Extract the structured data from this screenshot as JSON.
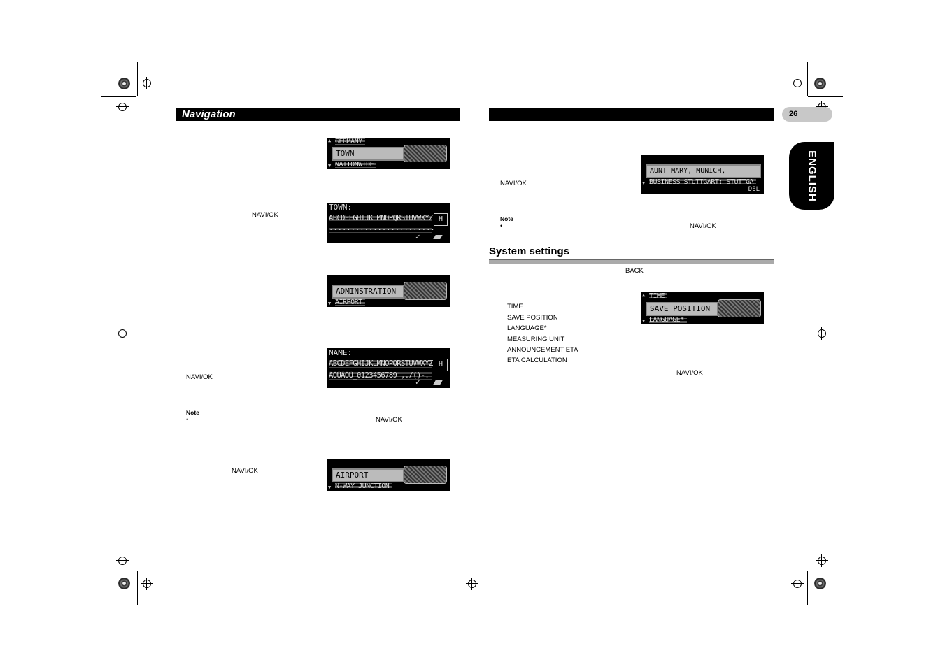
{
  "header": {
    "left_title": "Navigation",
    "right_title": "",
    "page_number": "26",
    "language_tab": "ENGLISH"
  },
  "screens": {
    "country": {
      "top": "GERMANY",
      "selected": "TOWN",
      "bottom": "NATIONWIDE"
    },
    "town_entry": {
      "label": "TOWN:",
      "keys": "ABCDEFGHIJKLMNOPQRSTUVWXYZ",
      "current": "H",
      "input": "························",
      "ok": "✓"
    },
    "category": {
      "selected": "ADMINSTRATION",
      "bottom": "AIRPORT"
    },
    "name_entry": {
      "label": "NAME:",
      "keys": "ABCDEFGHIJKLMNOPQRSTUVWXYZ",
      "keys2": "ÄÖÜÄÖÜ_0123456789',./()-.",
      "current": "H",
      "ok": "✓"
    },
    "airport": {
      "selected": "AIRPORT",
      "bottom": "N-WAY JUNCTION"
    },
    "address_book": {
      "selected": "AUNT MARY, MUNICH,",
      "bottom": "BUSINESS STUTTGART: STUTTGA",
      "del": "DEL"
    },
    "system": {
      "top": "TIME",
      "selected": "SAVE POSITION",
      "bottom": "LANGUAGE*"
    }
  },
  "left": {
    "navi_ok_1": "NAVI/OK",
    "navi_ok_2": "NAVI/OK",
    "note_label": "Note",
    "note_bullet": "•",
    "navi_ok_3": "NAVI/OK",
    "navi_ok_4": "NAVI/OK"
  },
  "right": {
    "navi_ok_1": "NAVI/OK",
    "note_label": "Note",
    "note_bullet": "•",
    "navi_ok_2": "NAVI/OK",
    "section_title": "System settings",
    "back": "BACK",
    "menu_items": [
      "TIME",
      "SAVE POSITION",
      "LANGUAGE*",
      "MEASURING UNIT",
      "ANNOUNCEMENT ETA",
      "ETA CALCULATION"
    ],
    "navi_ok_3": "NAVI/OK"
  }
}
